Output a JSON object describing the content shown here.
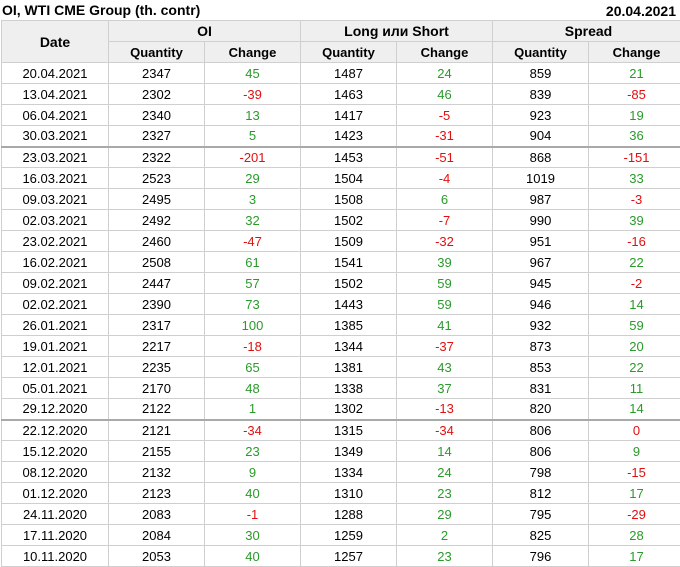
{
  "header": {
    "title": "OI, WTI CME Group (th. contr)",
    "date": "20.04.2021"
  },
  "table": {
    "date_header": "Date",
    "groups": [
      "OI",
      "Long или Short",
      "Spread"
    ],
    "sub_headers": [
      "Quantity",
      "Change",
      "Quantity",
      "Change",
      "Quantity",
      "Change"
    ],
    "rows": [
      {
        "date": "20.04.2021",
        "oi_q": "2347",
        "oi_c": "45",
        "ls_q": "1487",
        "ls_c": "24",
        "sp_q": "859",
        "sp_c": "21"
      },
      {
        "date": "13.04.2021",
        "oi_q": "2302",
        "oi_c": "-39",
        "ls_q": "1463",
        "ls_c": "46",
        "sp_q": "839",
        "sp_c": "-85"
      },
      {
        "date": "06.04.2021",
        "oi_q": "2340",
        "oi_c": "13",
        "ls_q": "1417",
        "ls_c": "-5",
        "sp_q": "923",
        "sp_c": "19"
      },
      {
        "date": "30.03.2021",
        "oi_q": "2327",
        "oi_c": "5",
        "ls_q": "1423",
        "ls_c": "-31",
        "sp_q": "904",
        "sp_c": "36"
      },
      {
        "date": "23.03.2021",
        "oi_q": "2322",
        "oi_c": "-201",
        "ls_q": "1453",
        "ls_c": "-51",
        "sp_q": "868",
        "sp_c": "-151",
        "sep": true
      },
      {
        "date": "16.03.2021",
        "oi_q": "2523",
        "oi_c": "29",
        "ls_q": "1504",
        "ls_c": "-4",
        "sp_q": "1019",
        "sp_c": "33"
      },
      {
        "date": "09.03.2021",
        "oi_q": "2495",
        "oi_c": "3",
        "ls_q": "1508",
        "ls_c": "6",
        "sp_q": "987",
        "sp_c": "-3"
      },
      {
        "date": "02.03.2021",
        "oi_q": "2492",
        "oi_c": "32",
        "ls_q": "1502",
        "ls_c": "-7",
        "sp_q": "990",
        "sp_c": "39"
      },
      {
        "date": "23.02.2021",
        "oi_q": "2460",
        "oi_c": "-47",
        "ls_q": "1509",
        "ls_c": "-32",
        "sp_q": "951",
        "sp_c": "-16"
      },
      {
        "date": "16.02.2021",
        "oi_q": "2508",
        "oi_c": "61",
        "ls_q": "1541",
        "ls_c": "39",
        "sp_q": "967",
        "sp_c": "22"
      },
      {
        "date": "09.02.2021",
        "oi_q": "2447",
        "oi_c": "57",
        "ls_q": "1502",
        "ls_c": "59",
        "sp_q": "945",
        "sp_c": "-2"
      },
      {
        "date": "02.02.2021",
        "oi_q": "2390",
        "oi_c": "73",
        "ls_q": "1443",
        "ls_c": "59",
        "sp_q": "946",
        "sp_c": "14"
      },
      {
        "date": "26.01.2021",
        "oi_q": "2317",
        "oi_c": "100",
        "ls_q": "1385",
        "ls_c": "41",
        "sp_q": "932",
        "sp_c": "59"
      },
      {
        "date": "19.01.2021",
        "oi_q": "2217",
        "oi_c": "-18",
        "ls_q": "1344",
        "ls_c": "-37",
        "sp_q": "873",
        "sp_c": "20"
      },
      {
        "date": "12.01.2021",
        "oi_q": "2235",
        "oi_c": "65",
        "ls_q": "1381",
        "ls_c": "43",
        "sp_q": "853",
        "sp_c": "22"
      },
      {
        "date": "05.01.2021",
        "oi_q": "2170",
        "oi_c": "48",
        "ls_q": "1338",
        "ls_c": "37",
        "sp_q": "831",
        "sp_c": "11"
      },
      {
        "date": "29.12.2020",
        "oi_q": "2122",
        "oi_c": "1",
        "ls_q": "1302",
        "ls_c": "-13",
        "sp_q": "820",
        "sp_c": "14"
      },
      {
        "date": "22.12.2020",
        "oi_q": "2121",
        "oi_c": "-34",
        "ls_q": "1315",
        "ls_c": "-34",
        "sp_q": "806",
        "sp_c": "0",
        "sep": true
      },
      {
        "date": "15.12.2020",
        "oi_q": "2155",
        "oi_c": "23",
        "ls_q": "1349",
        "ls_c": "14",
        "sp_q": "806",
        "sp_c": "9"
      },
      {
        "date": "08.12.2020",
        "oi_q": "2132",
        "oi_c": "9",
        "ls_q": "1334",
        "ls_c": "24",
        "sp_q": "798",
        "sp_c": "-15"
      },
      {
        "date": "01.12.2020",
        "oi_q": "2123",
        "oi_c": "40",
        "ls_q": "1310",
        "ls_c": "23",
        "sp_q": "812",
        "sp_c": "17"
      },
      {
        "date": "24.11.2020",
        "oi_q": "2083",
        "oi_c": "-1",
        "ls_q": "1288",
        "ls_c": "29",
        "sp_q": "795",
        "sp_c": "-29"
      },
      {
        "date": "17.11.2020",
        "oi_q": "2084",
        "oi_c": "30",
        "ls_q": "1259",
        "ls_c": "2",
        "sp_q": "825",
        "sp_c": "28"
      },
      {
        "date": "10.11.2020",
        "oi_q": "2053",
        "oi_c": "40",
        "ls_q": "1257",
        "ls_c": "23",
        "sp_q": "796",
        "sp_c": "17"
      }
    ]
  },
  "colors": {
    "positive": "#2a9a2a",
    "negative": "#e01010",
    "zero": "#e01010"
  }
}
